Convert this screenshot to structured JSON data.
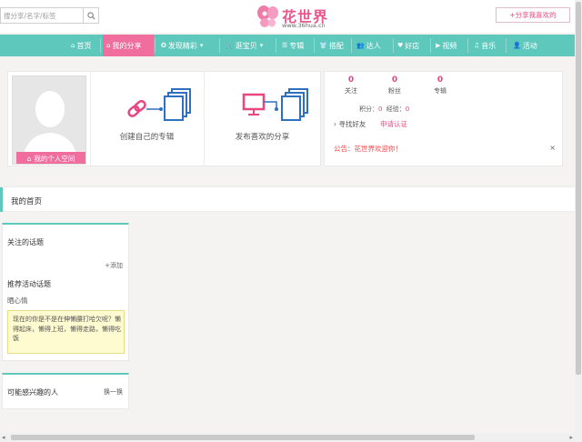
{
  "header": {
    "search_placeholder": "搜分享/名字/标签",
    "logo_name": "花世界",
    "logo_url": "www.36hua.cn",
    "share_button": "+分享我喜欢的",
    "brand_color": "#e8467f"
  },
  "nav": {
    "items": [
      {
        "label": "首页",
        "icon": "home-icon"
      },
      {
        "label": "我的分享",
        "icon": "home-icon",
        "active": true
      },
      {
        "label": "发现精彩",
        "icon": "compass-icon",
        "dropdown": true
      },
      {
        "label": "逛宝贝",
        "icon": "cart-icon",
        "dropdown": true
      },
      {
        "label": "专辑",
        "icon": "list-icon"
      },
      {
        "label": "搭配",
        "icon": "shirt-icon"
      },
      {
        "label": "达人",
        "icon": "users-icon"
      },
      {
        "label": "好店",
        "icon": "heart-icon"
      },
      {
        "label": "视频",
        "icon": "video-icon"
      },
      {
        "label": "音乐",
        "icon": "music-icon"
      },
      {
        "label": "活动",
        "icon": "people-icon"
      }
    ],
    "color": "#5ec8bc",
    "active_color": "#f06e9e"
  },
  "profile": {
    "home_button": "我的个人空间",
    "create_album": "创建自己的专辑",
    "publish_share": "发布喜欢的分享"
  },
  "stats": {
    "follow_num": "0",
    "follow_label": "关注",
    "fans_num": "0",
    "fans_label": "粉丝",
    "albums_num": "0",
    "albums_label": "专辑",
    "points_label": "积分：",
    "points_value": "0",
    "exp_label": "经验：",
    "exp_value": "0",
    "find_friends": "寻找好友",
    "apply_cert": "申请认证",
    "notice": "公告：花世界欢迎你！",
    "notice_close": "×"
  },
  "main": {
    "home_title": "我的首页"
  },
  "sidebar": {
    "followed_topics": "关注的话题",
    "add": "+添加",
    "recommended": "推荐活动话题",
    "topic": "晒心情",
    "tip": "现在的你是不是在伸懒腰打哈欠呢？懒得起床，懒得上班，懒得走路，懒得吃饭",
    "interested_people": "可能感兴趣的人",
    "switch": "换一换"
  }
}
